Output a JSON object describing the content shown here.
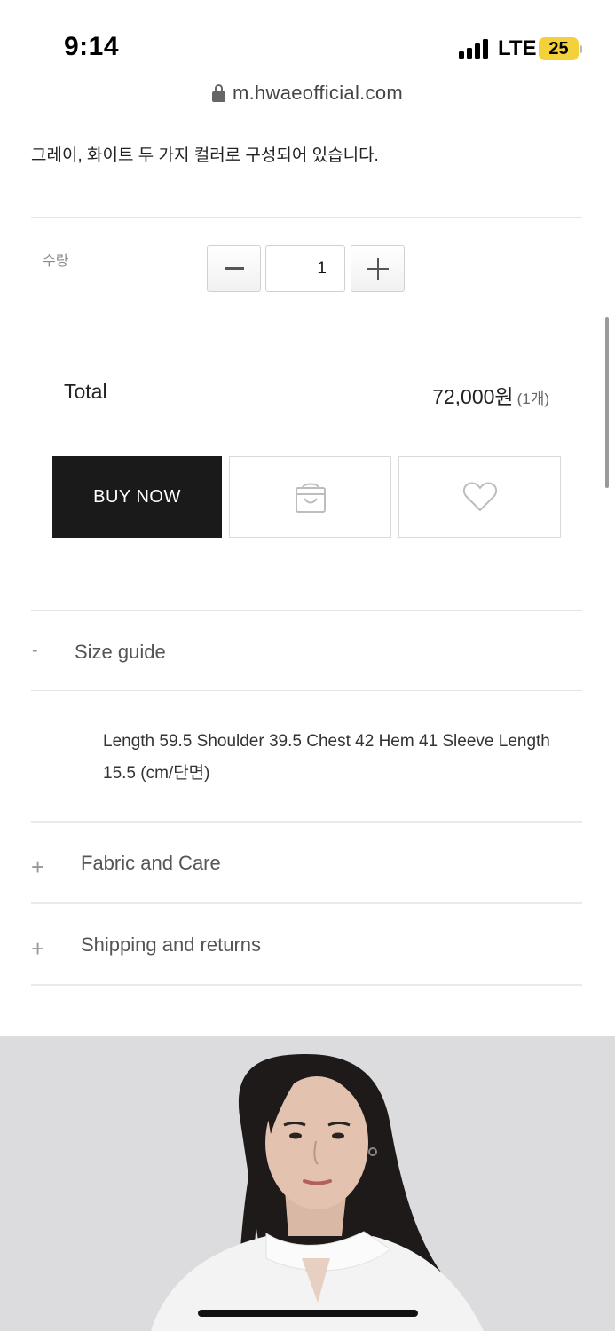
{
  "status_bar": {
    "time": "9:14",
    "network": "LTE",
    "battery": "25"
  },
  "browser": {
    "url": "m.hwaeofficial.com"
  },
  "product": {
    "description": "그레이, 화이트 두 가지 컬러로 구성되어 있습니다."
  },
  "quantity": {
    "label": "수량",
    "value": "1"
  },
  "total": {
    "label": "Total",
    "price": "72,000원",
    "count": "(1개)"
  },
  "actions": {
    "buy_now": "BUY NOW",
    "cart_icon": "shopping-bag-icon",
    "wish_icon": "heart-icon"
  },
  "accordions": [
    {
      "symbol": "-",
      "title": "Size guide",
      "content": "Length 59.5 Shoulder 39.5 Chest 42 Hem 41 Sleeve Length 15.5 (cm/단면)",
      "expanded": true
    },
    {
      "symbol": "+",
      "title": "Fabric and Care",
      "expanded": false
    },
    {
      "symbol": "+",
      "title": "Shipping and returns",
      "expanded": false
    }
  ],
  "colors": {
    "buy_button_bg": "#1a1a1a",
    "battery": "#f3d13a",
    "photo_bg": "#dcdcde"
  }
}
